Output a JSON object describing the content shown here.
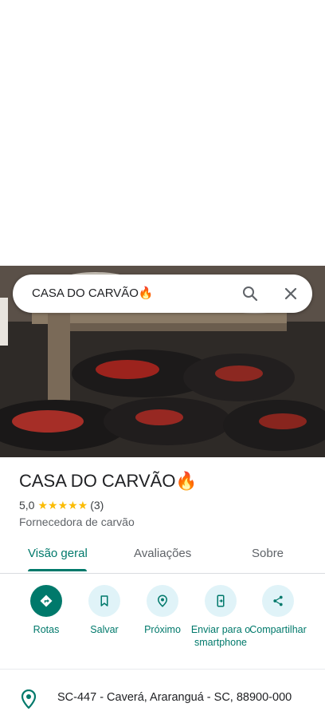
{
  "search": {
    "query": "CASA DO CARVÃO🔥"
  },
  "place": {
    "name": "CASA DO CARVÃO🔥",
    "rating": "5,0",
    "stars": "★★★★★",
    "review_count": "(3)",
    "category": "Fornecedora de carvão"
  },
  "tabs": [
    {
      "label": "Visão geral",
      "active": true
    },
    {
      "label": "Avaliações",
      "active": false
    },
    {
      "label": "Sobre",
      "active": false
    }
  ],
  "actions": [
    {
      "label": "Rotas",
      "icon": "directions-icon"
    },
    {
      "label": "Salvar",
      "icon": "bookmark-icon"
    },
    {
      "label": "Próximo",
      "icon": "nearby-icon"
    },
    {
      "label": "Enviar para o smartphone",
      "icon": "send-to-phone-icon"
    },
    {
      "label": "Compartilhar",
      "icon": "share-icon"
    }
  ],
  "address": "SC-447 - Caverá, Araranguá - SC, 88900-000",
  "colors": {
    "accent": "#00796b",
    "action_bg": "#e0f3f8",
    "star": "#fbbc04"
  }
}
